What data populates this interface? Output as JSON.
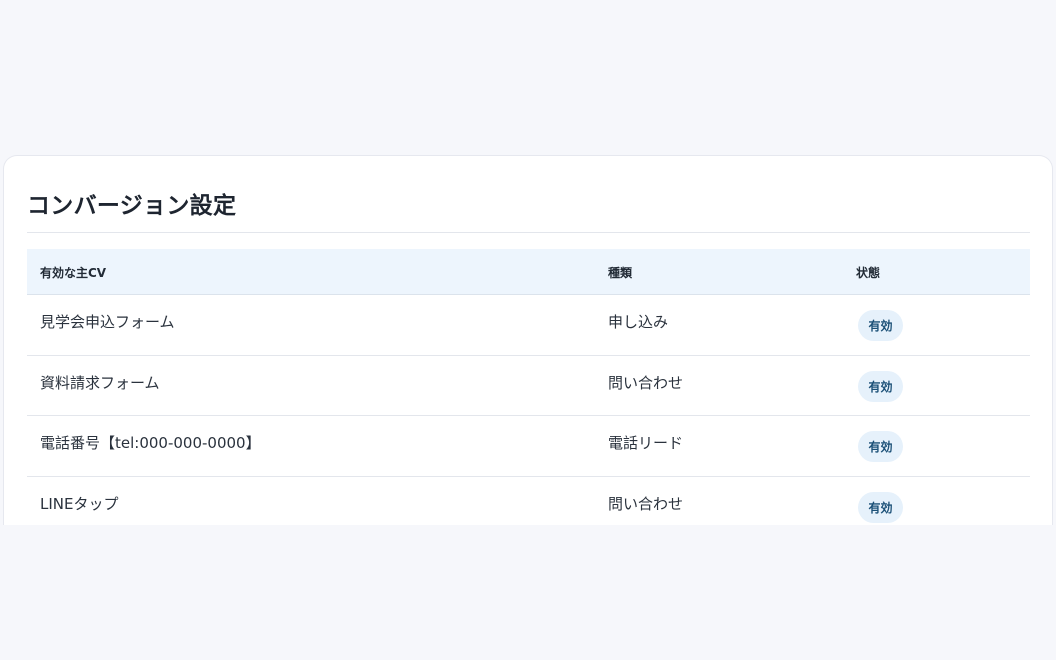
{
  "card": {
    "title": "コンバージョン設定"
  },
  "table": {
    "headers": {
      "name": "有効な主CV",
      "type": "種類",
      "status": "状態"
    },
    "rows": [
      {
        "name": "見学会申込フォーム",
        "type": "申し込み",
        "status": "有効"
      },
      {
        "name": "資料請求フォーム",
        "type": "問い合わせ",
        "status": "有効"
      },
      {
        "name": "電話番号【tel:000-000-0000】",
        "type": "電話リード",
        "status": "有効"
      },
      {
        "name": "LINEタップ",
        "type": "問い合わせ",
        "status": "有効"
      }
    ]
  },
  "colors": {
    "page_background": "#f6f7fb",
    "header_background": "#edf5fd",
    "badge_background": "#e6f1fb",
    "badge_text": "#1b5077"
  }
}
